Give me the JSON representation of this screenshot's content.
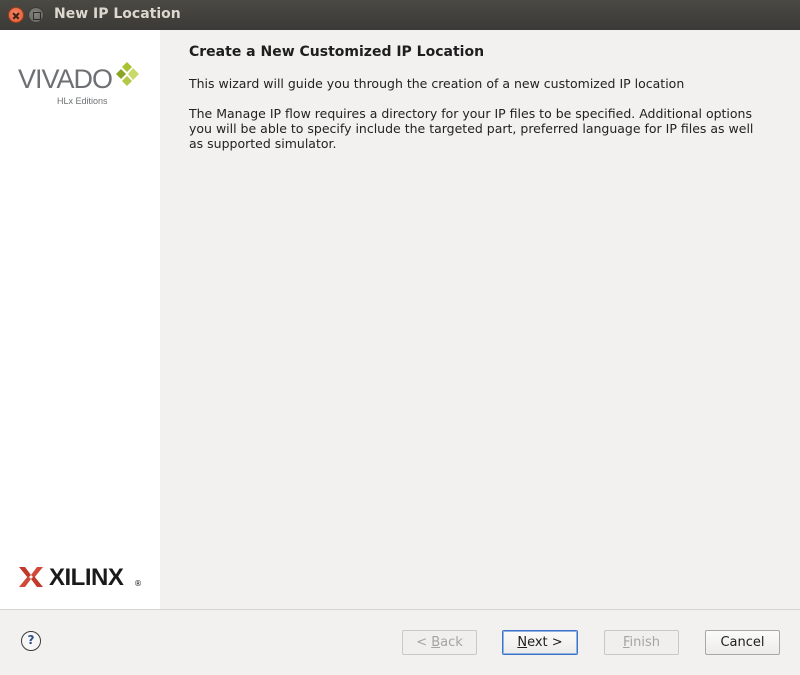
{
  "window": {
    "title": "New IP Location"
  },
  "sidebar": {
    "vivado_logo": {
      "word": "VIVADO",
      "subtitle": "HLx Editions",
      "icon": "vivado-diamond-icon"
    },
    "xilinx_logo": {
      "word": "XILINX",
      "reg_mark": "®",
      "icon": "xilinx-x-icon"
    }
  },
  "main": {
    "title": "Create a New Customized IP Location",
    "paragraphs": [
      "This wizard will guide you through the creation of a new customized IP location",
      "The Manage IP flow requires a directory for your IP files to be specified. Additional options you will be able to specify include the targeted part, preferred language for IP files as well as supported simulator."
    ]
  },
  "footer": {
    "help_label": "?",
    "back": {
      "prefix": "< ",
      "mnemonic": "B",
      "rest": "ack"
    },
    "next": {
      "mnemonic": "N",
      "rest": "ext >"
    },
    "finish": {
      "mnemonic": "F",
      "rest": "inish"
    },
    "cancel": {
      "label": "Cancel"
    }
  },
  "colors": {
    "titlebar": "#3b3a36",
    "sidebar_bg": "#ffffff",
    "content_bg": "#f2f1f0",
    "primary_border": "#3d74c7",
    "vivado_green": "#9bb52a",
    "xilinx_red": "#c0392b"
  }
}
